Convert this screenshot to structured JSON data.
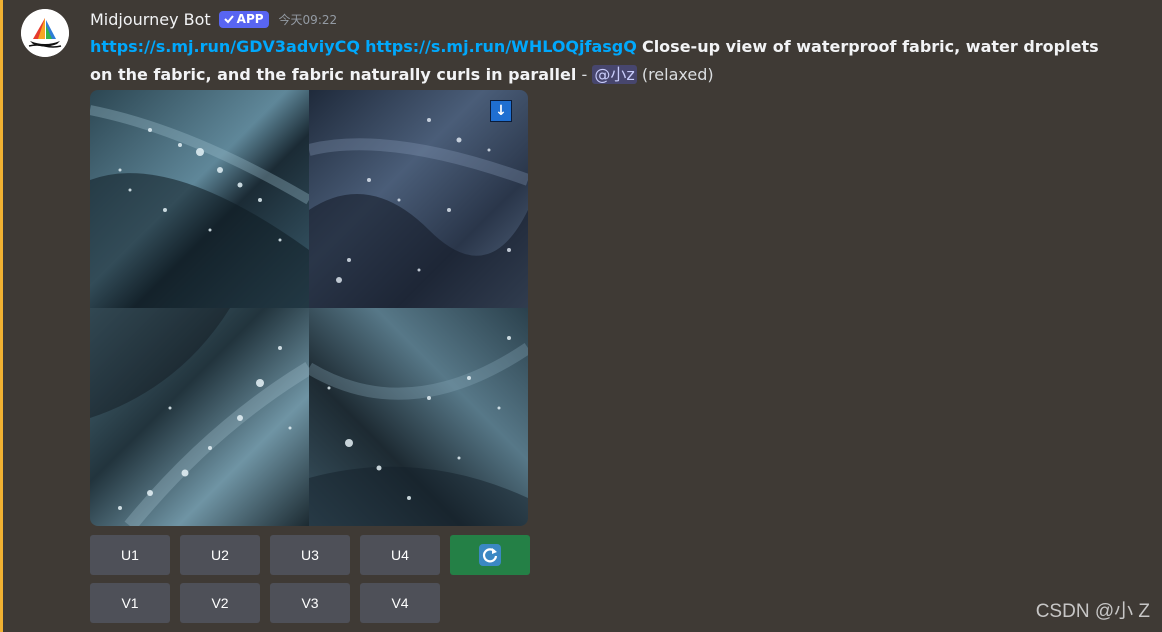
{
  "message": {
    "author": "Midjourney Bot",
    "badge": "APP",
    "timestamp": "今天09:22",
    "links": [
      "https://s.mj.run/GDV3adviyCQ",
      "https://s.mj.run/WHLOQjfasgQ"
    ],
    "prompt": "Close-up view of waterproof fabric, water droplets on the fabric, and the fabric naturally curls in parallel",
    "separator": "-",
    "mention": "@小z",
    "mode": "(relaxed)"
  },
  "image": {
    "download_label": "↓"
  },
  "buttons": {
    "upscale": [
      "U1",
      "U2",
      "U3",
      "U4"
    ],
    "variation": [
      "V1",
      "V2",
      "V3",
      "V4"
    ],
    "reroll_icon": "refresh-icon"
  },
  "colors": {
    "accent_mention_bar": "#f0b132",
    "link": "#00a8fc",
    "badge": "#5865f2",
    "button": "#4e5058",
    "reroll_button": "#248046",
    "background": "#3f3a35"
  },
  "watermark": "CSDN @小 Z"
}
